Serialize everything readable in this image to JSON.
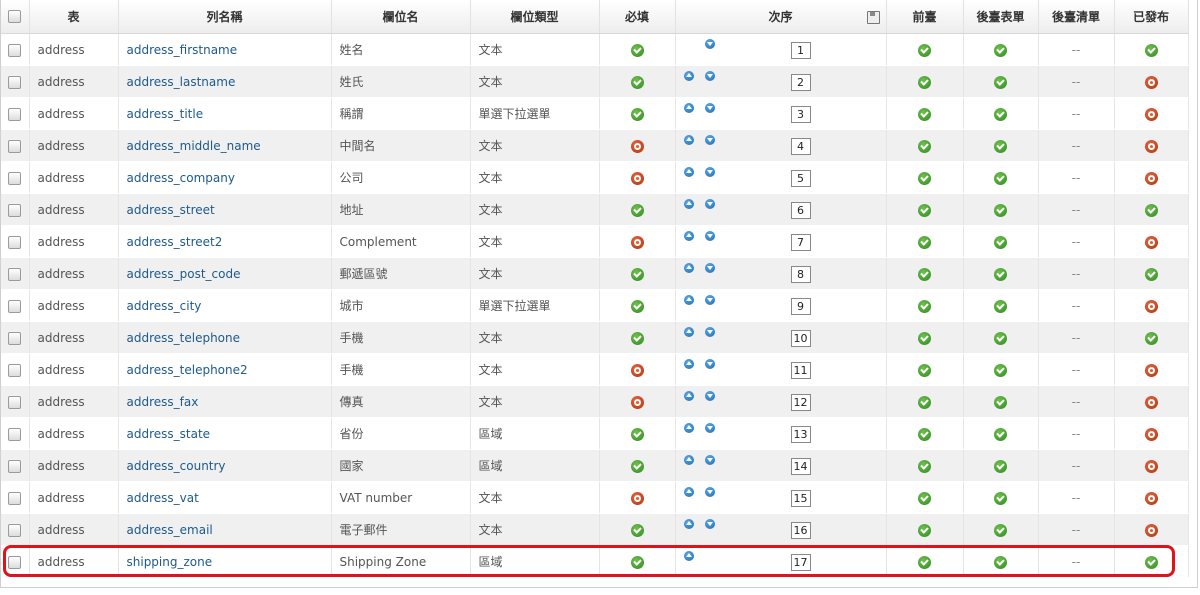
{
  "headers": {
    "table": "表",
    "column_name": "列名稱",
    "field_name": "欄位名",
    "field_type": "欄位類型",
    "required": "必填",
    "order": "次序",
    "frontend": "前臺",
    "backend_form": "後臺表單",
    "backend_list": "後臺清單",
    "published": "已發布"
  },
  "icons": {
    "check": "check-circle-icon",
    "cross": "cross-circle-icon",
    "order_up": "arrow-up-circle-icon",
    "order_down": "arrow-down-circle-icon",
    "save_order": "save-icon"
  },
  "colors": {
    "link": "#1e5a8a",
    "ok": "#3a9a2a",
    "no": "#c0401a",
    "highlight": "#e0121a"
  },
  "rows": [
    {
      "table": "address",
      "name": "address_firstname",
      "label": "姓名",
      "type": "文本",
      "required": true,
      "order": "1",
      "up": false,
      "down": true,
      "frontend": true,
      "backend_form": true,
      "backend_list": "--",
      "published": true
    },
    {
      "table": "address",
      "name": "address_lastname",
      "label": "姓氏",
      "type": "文本",
      "required": true,
      "order": "2",
      "up": true,
      "down": true,
      "frontend": true,
      "backend_form": true,
      "backend_list": "--",
      "published": false
    },
    {
      "table": "address",
      "name": "address_title",
      "label": "稱謂",
      "type": "單選下拉選單",
      "required": true,
      "order": "3",
      "up": true,
      "down": true,
      "frontend": true,
      "backend_form": true,
      "backend_list": "--",
      "published": false
    },
    {
      "table": "address",
      "name": "address_middle_name",
      "label": "中間名",
      "type": "文本",
      "required": false,
      "order": "4",
      "up": true,
      "down": true,
      "frontend": true,
      "backend_form": true,
      "backend_list": "--",
      "published": false
    },
    {
      "table": "address",
      "name": "address_company",
      "label": "公司",
      "type": "文本",
      "required": false,
      "order": "5",
      "up": true,
      "down": true,
      "frontend": true,
      "backend_form": true,
      "backend_list": "--",
      "published": false
    },
    {
      "table": "address",
      "name": "address_street",
      "label": "地址",
      "type": "文本",
      "required": true,
      "order": "6",
      "up": true,
      "down": true,
      "frontend": true,
      "backend_form": true,
      "backend_list": "--",
      "published": true
    },
    {
      "table": "address",
      "name": "address_street2",
      "label": "Complement",
      "type": "文本",
      "required": false,
      "order": "7",
      "up": true,
      "down": true,
      "frontend": true,
      "backend_form": true,
      "backend_list": "--",
      "published": false
    },
    {
      "table": "address",
      "name": "address_post_code",
      "label": "郵遞區號",
      "type": "文本",
      "required": true,
      "order": "8",
      "up": true,
      "down": true,
      "frontend": true,
      "backend_form": true,
      "backend_list": "--",
      "published": true
    },
    {
      "table": "address",
      "name": "address_city",
      "label": "城市",
      "type": "單選下拉選單",
      "required": true,
      "order": "9",
      "up": true,
      "down": true,
      "frontend": true,
      "backend_form": true,
      "backend_list": "--",
      "published": false
    },
    {
      "table": "address",
      "name": "address_telephone",
      "label": "手機",
      "type": "文本",
      "required": true,
      "order": "10",
      "up": true,
      "down": true,
      "frontend": true,
      "backend_form": true,
      "backend_list": "--",
      "published": true
    },
    {
      "table": "address",
      "name": "address_telephone2",
      "label": "手機",
      "type": "文本",
      "required": false,
      "order": "11",
      "up": true,
      "down": true,
      "frontend": true,
      "backend_form": true,
      "backend_list": "--",
      "published": false
    },
    {
      "table": "address",
      "name": "address_fax",
      "label": "傳真",
      "type": "文本",
      "required": false,
      "order": "12",
      "up": true,
      "down": true,
      "frontend": true,
      "backend_form": true,
      "backend_list": "--",
      "published": false
    },
    {
      "table": "address",
      "name": "address_state",
      "label": "省份",
      "type": "區域",
      "required": true,
      "order": "13",
      "up": true,
      "down": true,
      "frontend": true,
      "backend_form": true,
      "backend_list": "--",
      "published": false
    },
    {
      "table": "address",
      "name": "address_country",
      "label": "國家",
      "type": "區域",
      "required": true,
      "order": "14",
      "up": true,
      "down": true,
      "frontend": true,
      "backend_form": true,
      "backend_list": "--",
      "published": false
    },
    {
      "table": "address",
      "name": "address_vat",
      "label": "VAT number",
      "type": "文本",
      "required": false,
      "order": "15",
      "up": true,
      "down": true,
      "frontend": true,
      "backend_form": true,
      "backend_list": "--",
      "published": false
    },
    {
      "table": "address",
      "name": "address_email",
      "label": "電子郵件",
      "type": "文本",
      "required": true,
      "order": "16",
      "up": true,
      "down": true,
      "frontend": true,
      "backend_form": true,
      "backend_list": "--",
      "published": false
    },
    {
      "table": "address",
      "name": "shipping_zone",
      "label": "Shipping Zone",
      "type": "區域",
      "required": true,
      "order": "17",
      "up": true,
      "down": false,
      "frontend": true,
      "backend_form": true,
      "backend_list": "--",
      "published": true
    }
  ]
}
